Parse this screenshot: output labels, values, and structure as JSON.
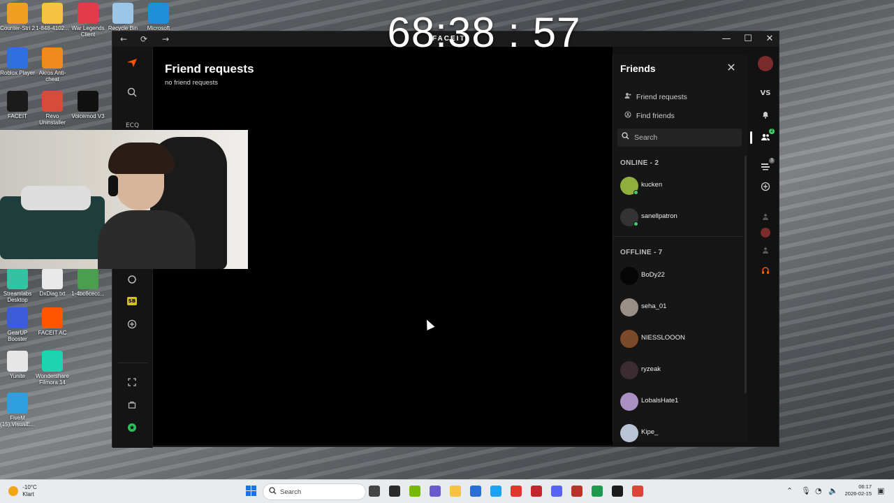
{
  "timer": "68:38 : 57",
  "desktop_icons": [
    {
      "label": "Counter-Stri 2",
      "color": "#f0a020"
    },
    {
      "label": "1-848-4102...",
      "color": "#f5c242"
    },
    {
      "label": "War Legends Client",
      "color": "#e23b4c"
    },
    {
      "label": "Recycle Bin",
      "color": "#9cc6e8"
    },
    {
      "label": "Microsoft",
      "color": "#1e8fd8"
    },
    {
      "label": "Roblox Player",
      "color": "#2f6fe0"
    },
    {
      "label": "Akros Anti-cheat",
      "color": "#f08a1c"
    },
    {
      "label": "FACEIT",
      "color": "#1b1b1b"
    },
    {
      "label": "Revo Uninstaller",
      "color": "#d84b3a"
    },
    {
      "label": "Voicemod V3",
      "color": "#111111"
    },
    {
      "label": "Streamlabs Desktop",
      "color": "#31c3a2"
    },
    {
      "label": "DxDiag.txt",
      "color": "#e9e9e9"
    },
    {
      "label": "1-4bc6cecc...",
      "color": "#4a9e4e"
    },
    {
      "label": "GearUP Booster",
      "color": "#3b5bdb"
    },
    {
      "label": "FACEIT AC",
      "color": "#ff5500"
    },
    {
      "label": "Yunite",
      "color": "#e6e6e6"
    },
    {
      "label": "Wondershare Filmora 14",
      "color": "#1dd3b0"
    },
    {
      "label": "FiveM (15).VisualE...",
      "color": "#2f9fe0"
    }
  ],
  "window": {
    "brand": "FACEIT",
    "back_glyph": "←",
    "reload_glyph": "⟳",
    "forward_glyph": "→",
    "minimize_glyph": "—",
    "maximize_glyph": "☐",
    "close_glyph": "✕"
  },
  "main": {
    "title": "Friend requests",
    "subtitle": "no friend requests"
  },
  "friends_panel": {
    "title": "Friends",
    "close_glyph": "✕",
    "links": [
      {
        "label": "Friend requests",
        "icon": "add-user-icon"
      },
      {
        "label": "Find friends",
        "icon": "find-icon"
      }
    ],
    "search": {
      "placeholder": "Search",
      "value": ""
    },
    "online_header": "ONLINE - 2",
    "offline_header": "OFFLINE - 7",
    "online": [
      {
        "name": "kucken",
        "color": "#8fae3c"
      },
      {
        "name": "sanellpatron",
        "color": "#333333"
      }
    ],
    "offline": [
      {
        "name": "BoDy22",
        "color": "#050505"
      },
      {
        "name": "seha_01",
        "color": "#9a8f86"
      },
      {
        "name": "NIESSLOOON",
        "color": "#7a4a2a"
      },
      {
        "name": "ryzeak",
        "color": "#3a2c30"
      },
      {
        "name": "LobalsHate1",
        "color": "#a98fc2"
      },
      {
        "name": "Kipe_",
        "color": "#b9c3d6"
      }
    ]
  },
  "right_rail": {
    "vs_label": "VS",
    "friends_badge": "2",
    "party_badge": "3",
    "headset_color": "#ff5500"
  },
  "left_rail": {
    "score_badge": "SB"
  },
  "taskbar": {
    "weather_temp": "-10°C",
    "weather_state": "Klart",
    "search_label": "Search",
    "time": "06:17",
    "date": "2026-02-15",
    "app_colors": [
      "#444444",
      "#2b2b2b",
      "#76b900",
      "#6a5acd",
      "#f5c242",
      "#2a6fd6",
      "#1da1f2",
      "#e2352e",
      "#c4262e",
      "#5865f2",
      "#b8322a",
      "#1c9a4e",
      "#1b1b1b",
      "#db4437"
    ]
  }
}
